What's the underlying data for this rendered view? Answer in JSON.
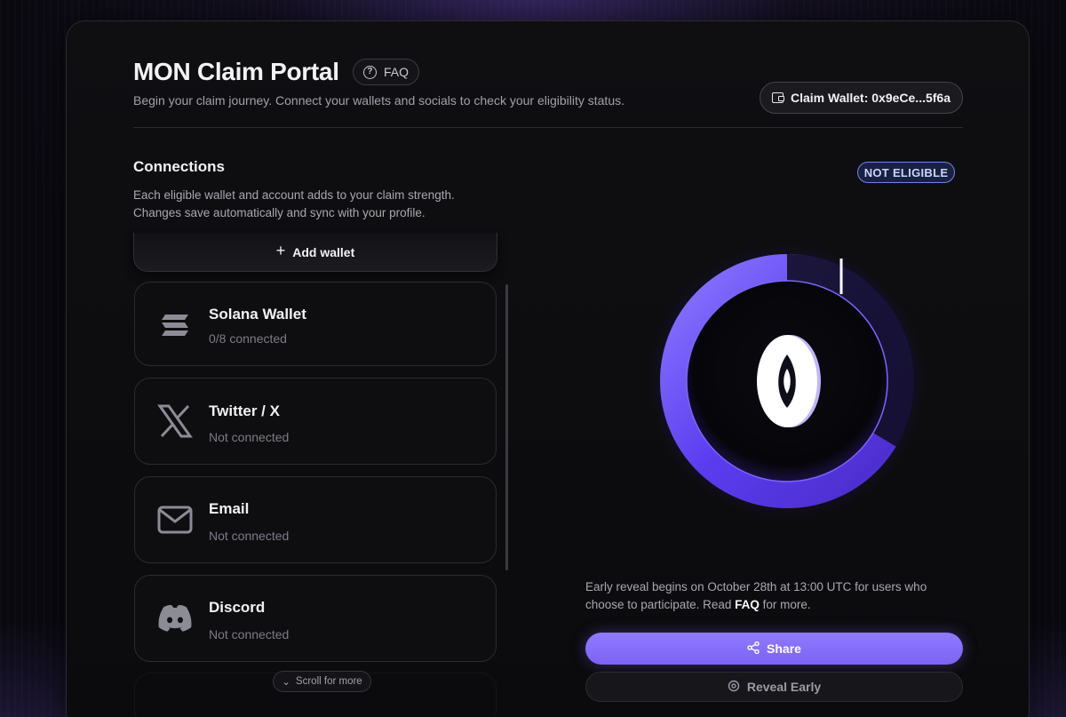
{
  "header": {
    "title": "MON Claim Portal",
    "faq_label": "FAQ",
    "subtitle": "Begin your claim journey. Connect your wallets and socials to check your eligibility status.",
    "claim_wallet_label": "Claim Wallet: 0x9eCe...5f6a"
  },
  "connections": {
    "title": "Connections",
    "description_line1": "Each eligible wallet and account adds to your claim strength.",
    "description_line2": "Changes save automatically and sync with your profile.",
    "add_wallet_label": "Add wallet",
    "items": [
      {
        "name": "Solana Wallet",
        "status": "0/8 connected",
        "icon": "solana-icon"
      },
      {
        "name": "Twitter / X",
        "status": "Not connected",
        "icon": "x-icon"
      },
      {
        "name": "Email",
        "status": "Not connected",
        "icon": "mail-icon"
      },
      {
        "name": "Discord",
        "status": "Not connected",
        "icon": "discord-icon"
      }
    ],
    "scroll_more_label": "Scroll for more"
  },
  "eligibility": {
    "badge": "NOT ELIGIBLE",
    "reveal_text_before": "Early reveal begins on October 28th at 13:00 UTC for users who choose to participate. Read ",
    "reveal_text_link": "FAQ",
    "reveal_text_after": " for more.",
    "share_label": "Share",
    "reveal_early_label": "Reveal Early"
  },
  "colors": {
    "accent": "#8a74ff",
    "badge_border": "#6a86e6",
    "ring": "#5b3df0"
  }
}
